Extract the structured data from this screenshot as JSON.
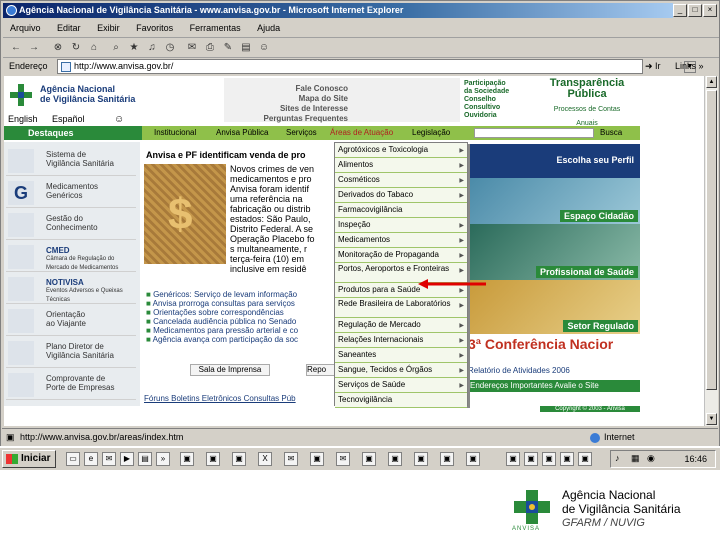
{
  "window": {
    "title": "Agência Nacional de Vigilância Sanitária - www.anvisa.gov.br - Microsoft Internet Explorer"
  },
  "menubar": [
    "Arquivo",
    "Editar",
    "Exibir",
    "Favoritos",
    "Ferramentas",
    "Ajuda"
  ],
  "address": {
    "label": "Endereço",
    "url": "http://www.anvisa.gov.br/",
    "go": "Ir",
    "links": "Links »"
  },
  "site": {
    "logo_line1": "Agência Nacional",
    "logo_line2": "de Vigilância Sanitária",
    "lang_en": "English",
    "lang_es": "Español",
    "top_links": [
      "Fale Conosco",
      "Mapa do Site",
      "Sites de Interesse",
      "Perguntas Frequentes"
    ],
    "participacao": [
      "Participação",
      "da Sociedade",
      "Conselho",
      "Consultivo",
      "Ouvidoria"
    ],
    "transparencia_1": "Transparência",
    "transparencia_2": "Pública",
    "processos_1": "Processos de Contas",
    "processos_2": "Anuais",
    "nav": {
      "destaques": "Destaques",
      "items": [
        "Institucional",
        "Anvisa Pública",
        "Serviços",
        "Áreas de Atuação",
        "Legislação"
      ],
      "busca": "Busca"
    },
    "sidebar": [
      {
        "l1": "Sistema de",
        "l2": "Vigilância Sanitária"
      },
      {
        "l1": "Medicamentos",
        "l2": "Genéricos"
      },
      {
        "l1": "Gestão do",
        "l2": "Conhecimento"
      },
      {
        "l1": "CMED",
        "l2": "Câmara de Regulação do Mercado de Medicamentos"
      },
      {
        "l1": "NOTIVISA",
        "l2": "Eventos Adversos e Queixas Técnicas"
      },
      {
        "l1": "Orientação",
        "l2": "ao Viajante"
      },
      {
        "l1": "Plano Diretor de",
        "l2": "Vigilância Sanitária"
      },
      {
        "l1": "Comprovante de",
        "l2": "Porte de Empresas"
      }
    ],
    "headline": "Anvisa e PF identificam venda de pro",
    "article": [
      "Novos crimes de ven",
      "medicamentos e pro",
      "Anvisa foram identif",
      "uma referência na",
      "fabricação ou distrib",
      "estados: São Paulo,",
      "Distrito Federal. A se",
      "Operação Placebo fo",
      "s multaneamente, r",
      "terça-feira (10) em",
      "inclusive em residê"
    ],
    "news": [
      "Genéricos: Serviço de levam informação",
      "Anvisa prorroga consultas para serviços",
      "Orientações sobre correspondências",
      "Cancelada audiência pública no Senado",
      "Medicamentos para pressão arterial e co",
      "Agência avança com participação da soc"
    ],
    "sala": "Sala de Imprensa",
    "repo": "Repo",
    "footer_links": "Fóruns  Boletins Eletrônicos  Consultas Púb",
    "right": {
      "perfil": "Escolha seu Perfil",
      "cidadao": "Espaço Cidadão",
      "saude": "Profissional de Saúde",
      "regulado": "Setor Regulado",
      "conferencia": "3ª Conferência Nacior",
      "relatorio": "Relatório de Atividades 2006",
      "enderecos": "Endereços Importantes  Avalie o Site",
      "copyright": "Copyright © 2003 - Anvisa"
    },
    "dropdown": [
      "Agrotóxicos e Toxicologia",
      "Alimentos",
      "Cosméticos",
      "Derivados do Tabaco",
      "Farmacovigilância",
      "Inspeção",
      "Medicamentos",
      "Monitoração de Propaganda",
      "Portos, Aeroportos e Fronteiras",
      "Produtos para a Saúde",
      "Rede Brasileira de Laboratórios",
      "Regulação de Mercado",
      "Relações Internacionais",
      "Saneantes",
      "Sangue, Tecidos e Órgãos",
      "Serviços de Saúde",
      "Tecnovigilância"
    ]
  },
  "statusbar": {
    "url": "http://www.anvisa.gov.br/areas/index.htm",
    "zone": "Internet"
  },
  "taskbar": {
    "start": "Iniciar",
    "clock": "16:46"
  },
  "brand": {
    "line1": "Agência Nacional",
    "line2": "de Vigilância Sanitária",
    "sub": "GFARM / NUVIG",
    "logo_caption": "ANVISA"
  }
}
